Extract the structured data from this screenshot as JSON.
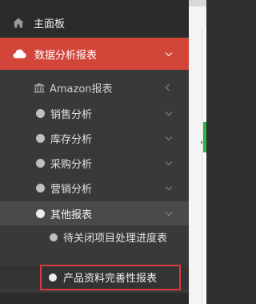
{
  "sidebar": {
    "dashboard": {
      "label": "主面板",
      "icon": "home-icon"
    },
    "data_analysis": {
      "label": "数据分析报表",
      "icon": "cloud-icon",
      "accent": "#d2463a"
    },
    "items": [
      {
        "label": "Amazon报表",
        "icon": "bank-icon"
      },
      {
        "label": "销售分析"
      },
      {
        "label": "库存分析"
      },
      {
        "label": "采购分析"
      },
      {
        "label": "营销分析"
      },
      {
        "label": "其他报表"
      }
    ],
    "other_children": [
      {
        "label": "待关闭项目处理进度表"
      },
      {
        "label": "产品资料完善性报表",
        "highlight": "#d93a3a"
      }
    ]
  }
}
